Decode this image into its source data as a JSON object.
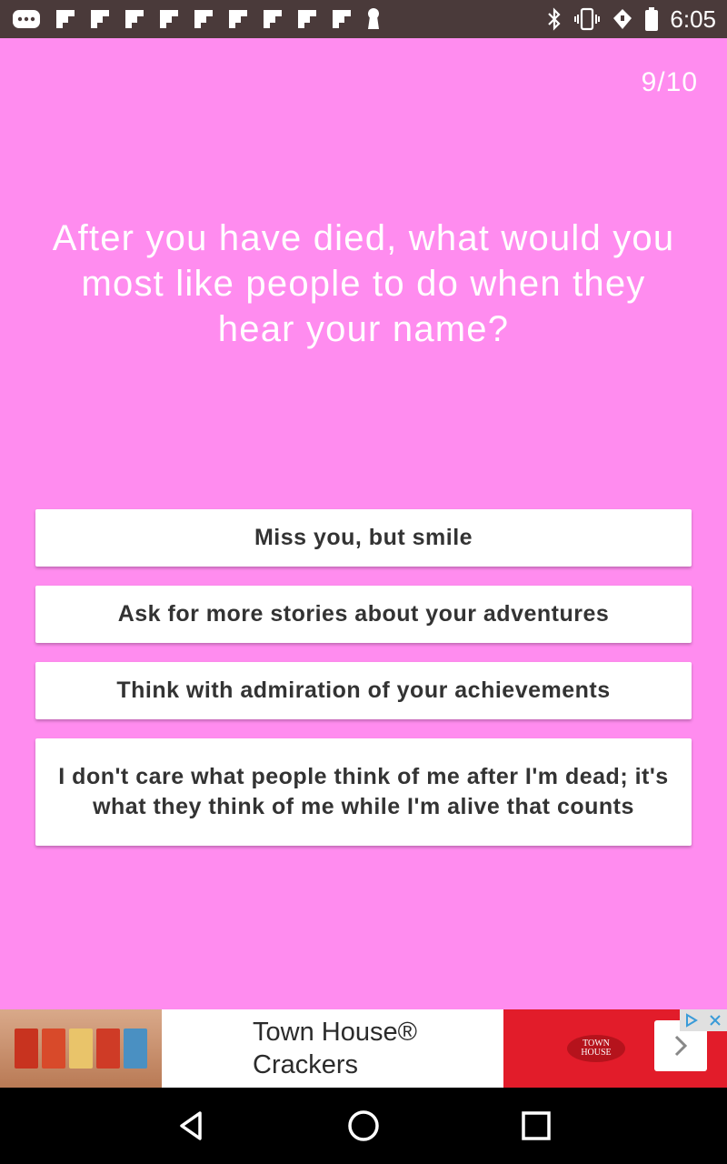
{
  "status_bar": {
    "time": "6:05",
    "left_icons": [
      "message-icon",
      "flipboard-icon",
      "flipboard-icon",
      "flipboard-icon",
      "flipboard-icon",
      "flipboard-icon",
      "flipboard-icon",
      "flipboard-icon",
      "flipboard-icon",
      "flipboard-icon",
      "keyhole-icon"
    ],
    "right_icons": [
      "bluetooth-icon",
      "vibrate-icon",
      "wifi-icon",
      "battery-icon"
    ]
  },
  "quiz": {
    "progress": "9/10",
    "question": "After you have died, what would you most like people to do when they hear your name?",
    "answers": [
      "Miss you, but smile",
      "Ask for more stories about your adventures",
      "Think with admiration of your achievements",
      "I don't care what people think of me after I'm dead; it's what they think of me while I'm alive that counts"
    ]
  },
  "ad": {
    "line1": "Town House®",
    "line2": "Crackers",
    "brand_logo": "TOWN HOUSE",
    "brand_color": "#e21c2a",
    "icons": [
      "adchoices-icon",
      "close-icon",
      "chevron-right-icon"
    ]
  },
  "colors": {
    "background": "#ff8cef",
    "status_bar": "#4a3a3a",
    "answer_bg": "#ffffff",
    "answer_text": "#333333"
  },
  "nav_bar": {
    "buttons": [
      "back-icon",
      "home-icon",
      "recents-icon"
    ]
  }
}
